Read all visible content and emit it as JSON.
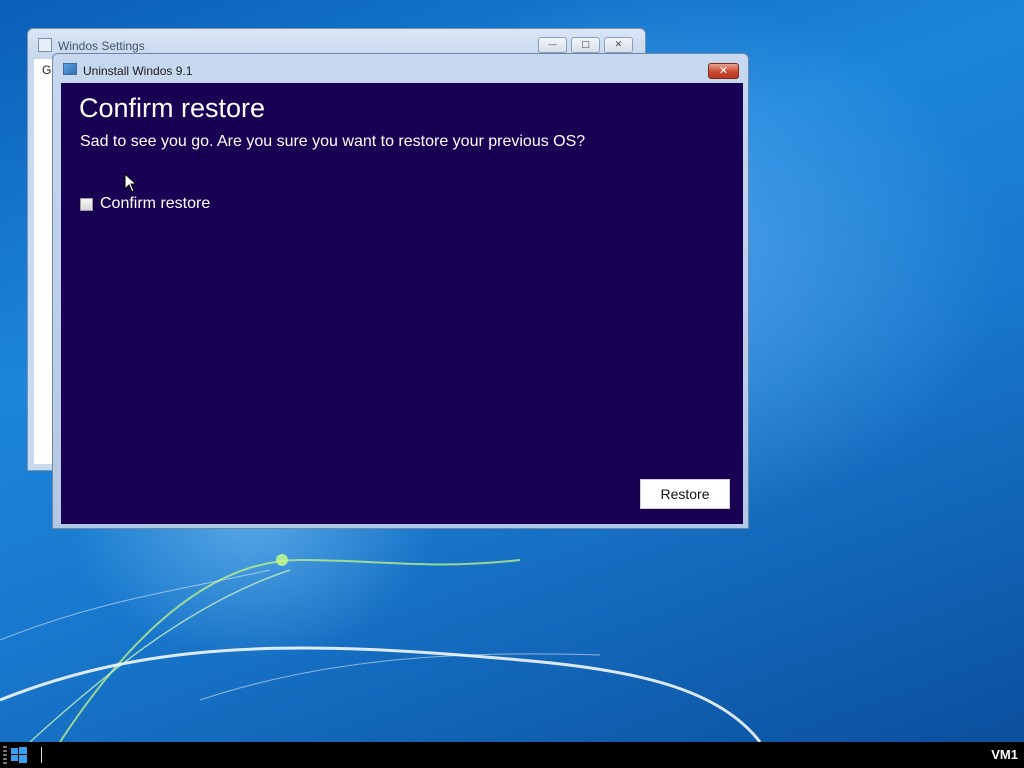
{
  "back_window": {
    "title": "Windos Settings",
    "client_text": "G",
    "minimize_glyph": "—",
    "maximize_glyph": "□",
    "close_glyph": "✕"
  },
  "dialog": {
    "title": "Uninstall Windos 9.1",
    "close_glyph": "✕",
    "heading": "Confirm restore",
    "message": "Sad to see you go. Are you sure you want to restore your previous OS?",
    "checkbox": {
      "label": "Confirm restore",
      "checked": false
    },
    "restore_button": "Restore"
  },
  "taskbar": {
    "vm_label": "VM1"
  },
  "colors": {
    "dialog_background": "#180052",
    "text": "#ffffff"
  }
}
